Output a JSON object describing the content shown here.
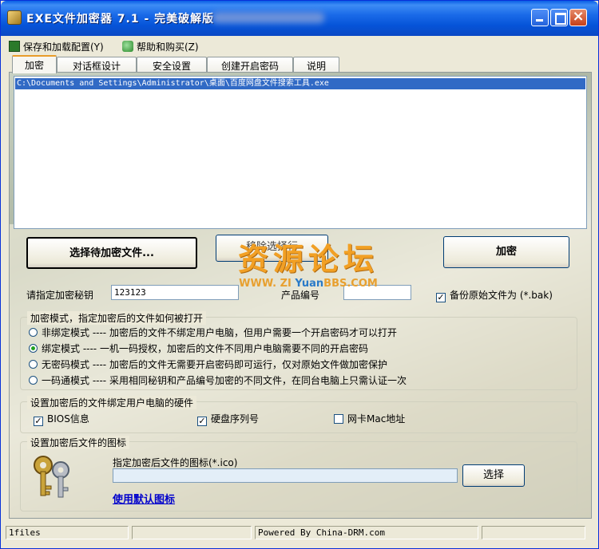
{
  "window": {
    "title": "EXE文件加密器 7.1 - 完美破解版",
    "icon": "keys-icon"
  },
  "menu": [
    {
      "label": "保存和加载配置(Y)",
      "icon": "save-icon"
    },
    {
      "label": "帮助和购买(Z)",
      "icon": "help-icon"
    }
  ],
  "tabs": [
    "加密",
    "对话框设计",
    "安全设置",
    "创建开启密码",
    "说明"
  ],
  "active_tab": "加密",
  "file_list": {
    "items": [
      "C:\\Documents and Settings\\Administrator\\桌面\\百度网盘文件搜索工具.exe"
    ]
  },
  "buttons": {
    "select_files": "选择待加密文件...",
    "remove": "移除选择行",
    "encrypt": "加密",
    "choose_icon": "选择",
    "default_icon": "使用默认图标"
  },
  "watermark": {
    "cn": "资源论坛",
    "url_prefix": "WWW.",
    "url_zi": "ZI",
    "url_yuan": "Yuan",
    "url_bbs": "BBS",
    "url_suffix": ".COM"
  },
  "key": {
    "label": "请指定加密秘钥",
    "value": "123123",
    "product_label": "产品编号",
    "product_value": ""
  },
  "backup": {
    "label": "备份原始文件为 (*.bak)",
    "checked": true
  },
  "mode_group": {
    "title": "加密模式，指定加密后的文件如何被打开",
    "options": [
      {
        "label": "非绑定模式 ---- 加密后的文件不绑定用户电脑，但用户需要一个开启密码才可以打开",
        "selected": false
      },
      {
        "label": "绑定模式 ---- 一机一码授权，加密后的文件不同用户电脑需要不同的开启密码",
        "selected": true
      },
      {
        "label": "无密码模式 ---- 加密后的文件无需要开启密码即可运行，仅对原始文件做加密保护",
        "selected": false
      },
      {
        "label": "一码通模式 ---- 采用相同秘钥和产品编号加密的不同文件，在同台电脑上只需认证一次",
        "selected": false
      }
    ]
  },
  "hw_group": {
    "title": "设置加密后的文件绑定用户电脑的硬件",
    "items": [
      {
        "label": "BIOS信息",
        "checked": true
      },
      {
        "label": "硬盘序列号",
        "checked": true
      },
      {
        "label": "网卡Mac地址",
        "checked": false
      }
    ]
  },
  "icon_group": {
    "title": "设置加密后文件的图标",
    "prompt": "指定加密后文件的图标(*.ico)",
    "path": ""
  },
  "status": {
    "files": "1files",
    "middle": "",
    "powered": "Powered By China-DRM.com",
    "right": ""
  }
}
